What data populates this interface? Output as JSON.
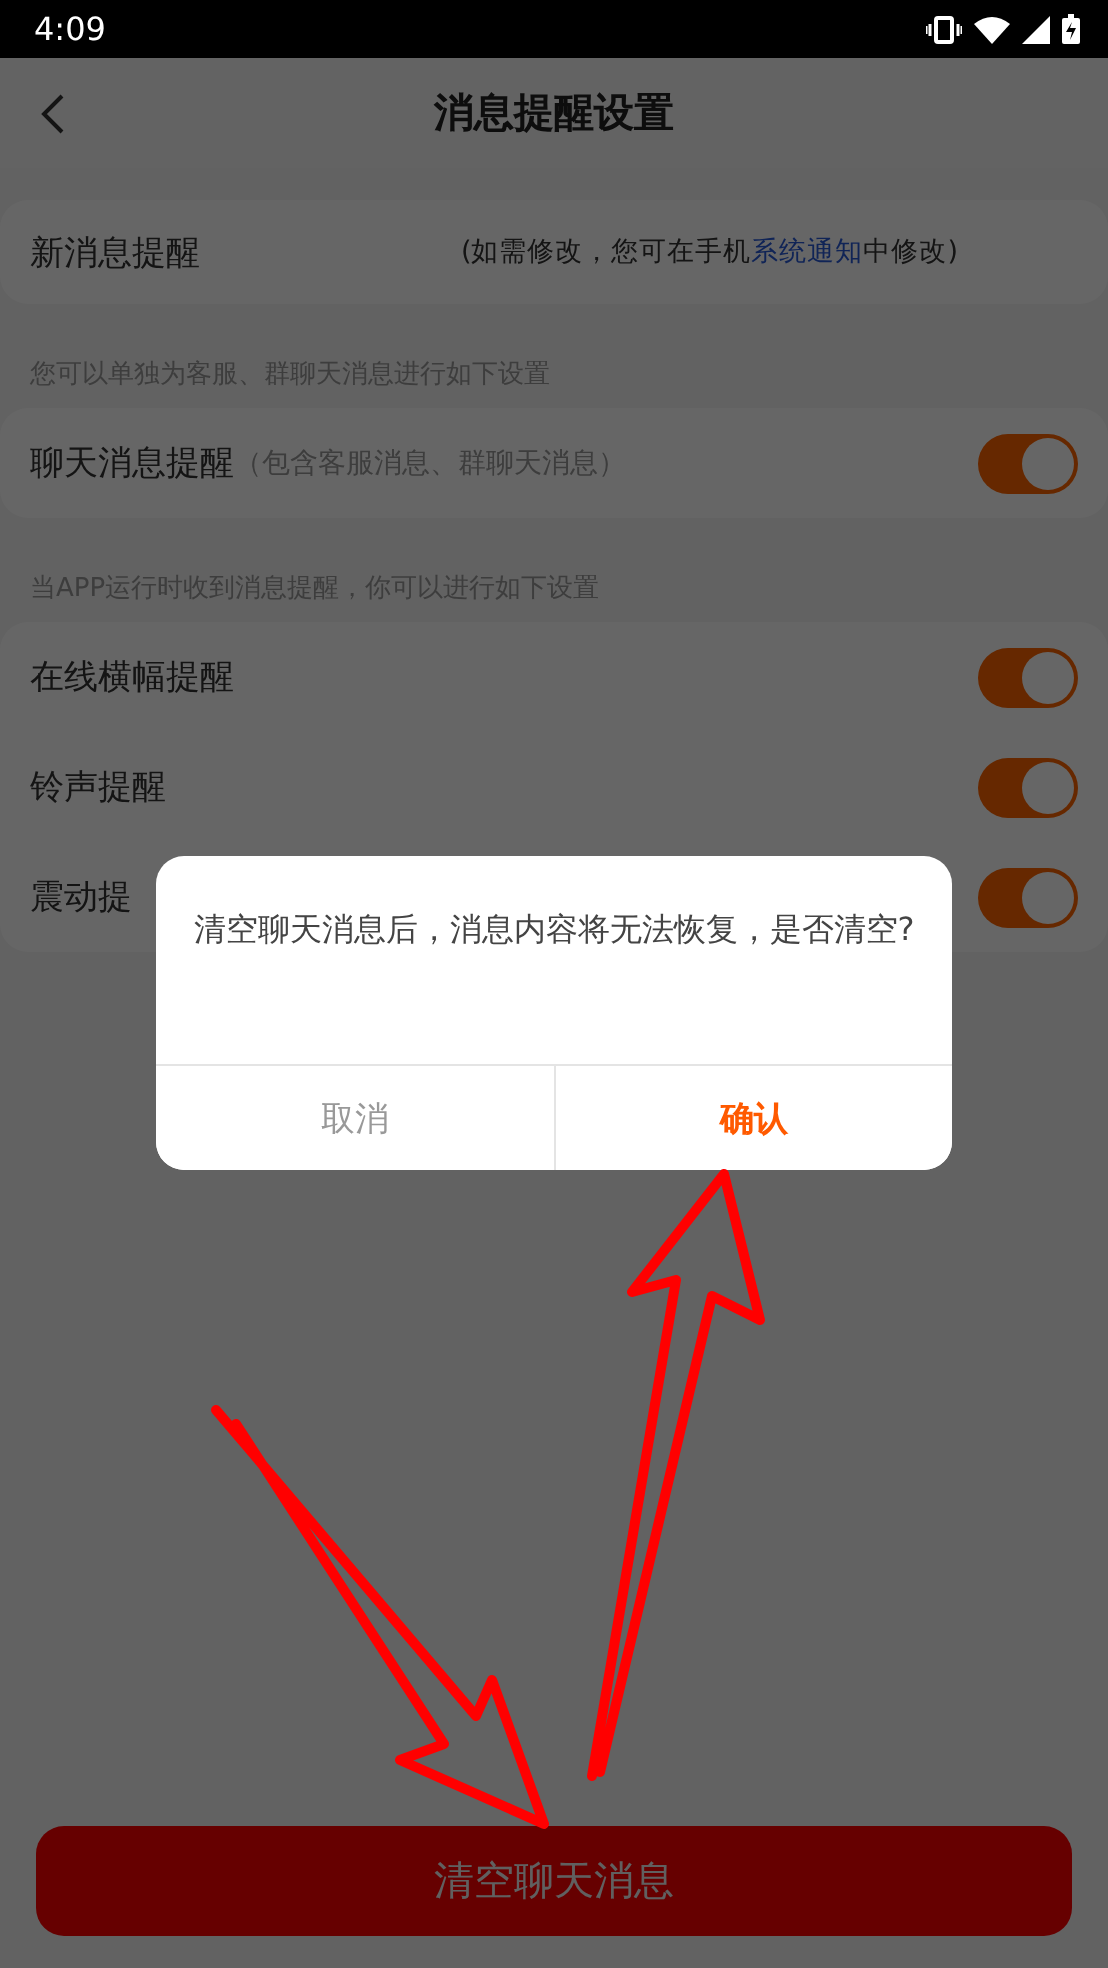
{
  "status_bar": {
    "time": "4:09"
  },
  "header": {
    "title": "消息提醒设置"
  },
  "notice": {
    "label": "新消息提醒",
    "hint_before": "(如需修改，您可在手机",
    "link": "系统通知",
    "hint_after": "中修改)"
  },
  "sections": [
    {
      "caption": "您可以单独为客服、群聊天消息进行如下设置",
      "rows": [
        {
          "label": "聊天消息提醒",
          "note": "（包含客服消息、群聊天消息）",
          "on": true
        }
      ]
    },
    {
      "caption": "当APP运行时收到消息提醒，你可以进行如下设置",
      "rows": [
        {
          "label": "在线横幅提醒",
          "on": true
        },
        {
          "label": "铃声提醒",
          "on": true
        },
        {
          "label": "震动提",
          "on": true
        }
      ]
    }
  ],
  "clear_button": {
    "label": "清空聊天消息"
  },
  "dialog": {
    "message": "清空聊天消息后，消息内容将无法恢复，是否清空?",
    "buttons": [
      {
        "label": "取消",
        "kind": "cancel"
      },
      {
        "label": "确认",
        "kind": "confirm"
      }
    ]
  }
}
